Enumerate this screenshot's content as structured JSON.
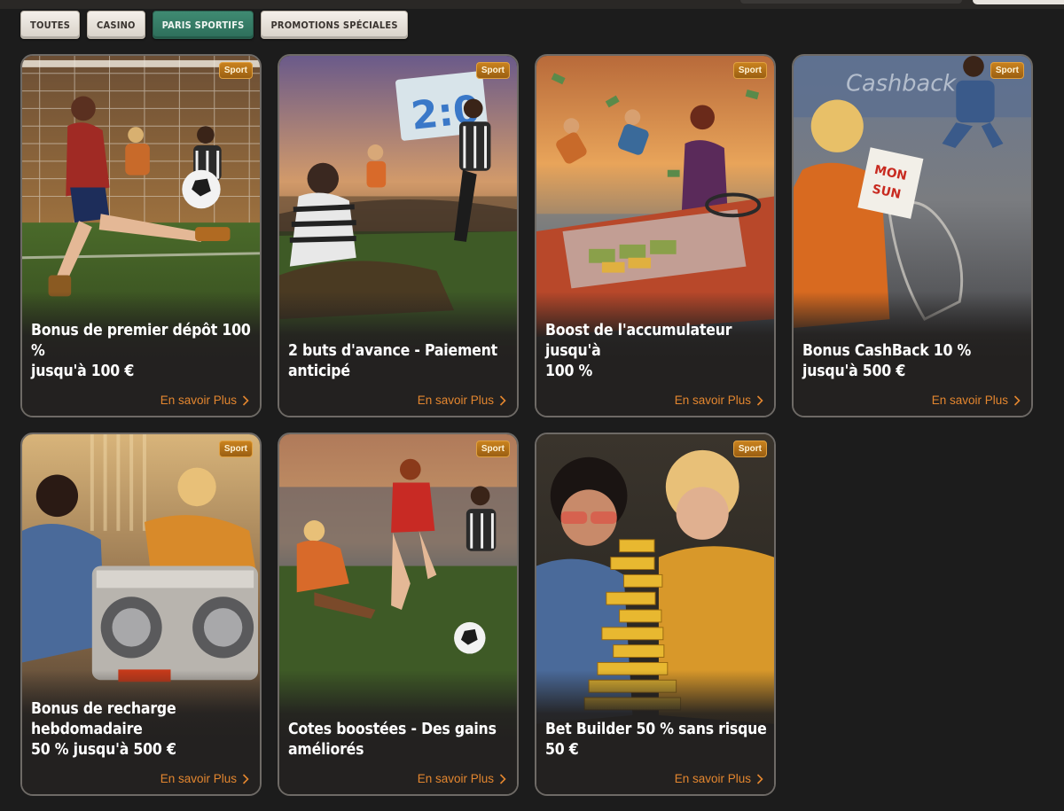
{
  "filters": [
    {
      "label": "TOUTES",
      "active": false
    },
    {
      "label": "CASINO",
      "active": false
    },
    {
      "label": "PARIS SPORTIFS",
      "active": true
    },
    {
      "label": "PROMOTIONS SPÉCIALES",
      "active": false
    }
  ],
  "cards": [
    {
      "badge": "Sport",
      "title_line1": "Bonus de premier dépôt 100 %",
      "title_line2": "jusqu'à 100 €",
      "link": "En savoir Plus"
    },
    {
      "badge": "Sport",
      "title_line1": "",
      "title_line2": "2 buts d'avance - Paiement anticipé",
      "link": "En savoir Plus",
      "scoreboard": "2:0"
    },
    {
      "badge": "Sport",
      "title_line1": "Boost de l'accumulateur jusqu'à",
      "title_line2": "100 %",
      "link": "En savoir Plus"
    },
    {
      "badge": "Sport",
      "title_line1": "",
      "title_line2": "Bonus CashBack 10 % jusqu'à 500 €",
      "link": "En savoir Plus",
      "wall_text": "Cashback",
      "sign_line1": "MON",
      "sign_line2": "SUN"
    },
    {
      "badge": "Sport",
      "title_line1": "Bonus de recharge hebdomadaire",
      "title_line2": "50 % jusqu'à 500 €",
      "link": "En savoir Plus"
    },
    {
      "badge": "Sport",
      "title_line1": "Cotes boostées - Des gains",
      "title_line2": "améliorés",
      "link": "En savoir Plus"
    },
    {
      "badge": "Sport",
      "title_line1": "",
      "title_line2": "Bet Builder 50 % sans risque 50 €",
      "link": "En savoir Plus"
    }
  ],
  "colors": {
    "background": "#1c1c1c",
    "active_filter": "#3f8a72",
    "link_orange": "#e3862f",
    "badge_orange": "#c9821e"
  },
  "icons": {
    "link_arrow": "chevron-right-icon"
  }
}
